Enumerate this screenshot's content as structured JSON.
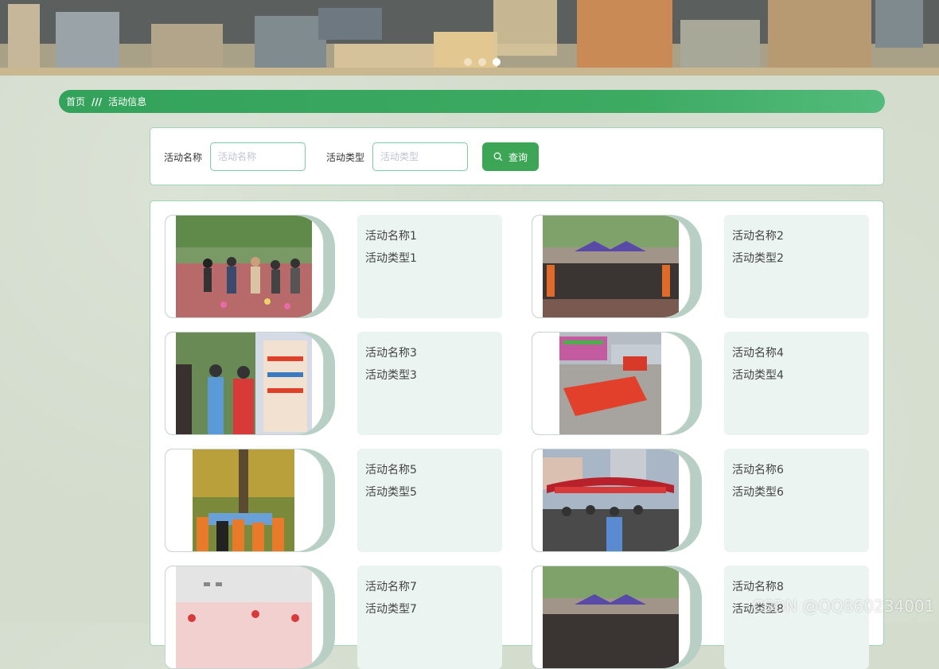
{
  "banner": {
    "slides_count": 3,
    "active_slide": 3
  },
  "breadcrumb": {
    "home": "首页",
    "separator": "///",
    "current": "活动信息"
  },
  "search": {
    "name_label": "活动名称",
    "name_placeholder": "活动名称",
    "type_label": "活动类型",
    "type_placeholder": "活动类型",
    "button_label": "查询",
    "button_icon": "search-icon"
  },
  "activities": [
    {
      "name": "活动名称1",
      "type": "活动类型1"
    },
    {
      "name": "活动名称2",
      "type": "活动类型2"
    },
    {
      "name": "活动名称3",
      "type": "活动类型3"
    },
    {
      "name": "活动名称4",
      "type": "活动类型4"
    },
    {
      "name": "活动名称5",
      "type": "活动类型5"
    },
    {
      "name": "活动名称6",
      "type": "活动类型6"
    },
    {
      "name": "活动名称7",
      "type": "活动类型7"
    },
    {
      "name": "活动名称8",
      "type": "活动类型8"
    }
  ],
  "watermark": "CSDN @QQ860234001",
  "colors": {
    "accent": "#3ca556",
    "card_info_bg": "#ebf4f0",
    "page_bg": "#d3dccd"
  }
}
